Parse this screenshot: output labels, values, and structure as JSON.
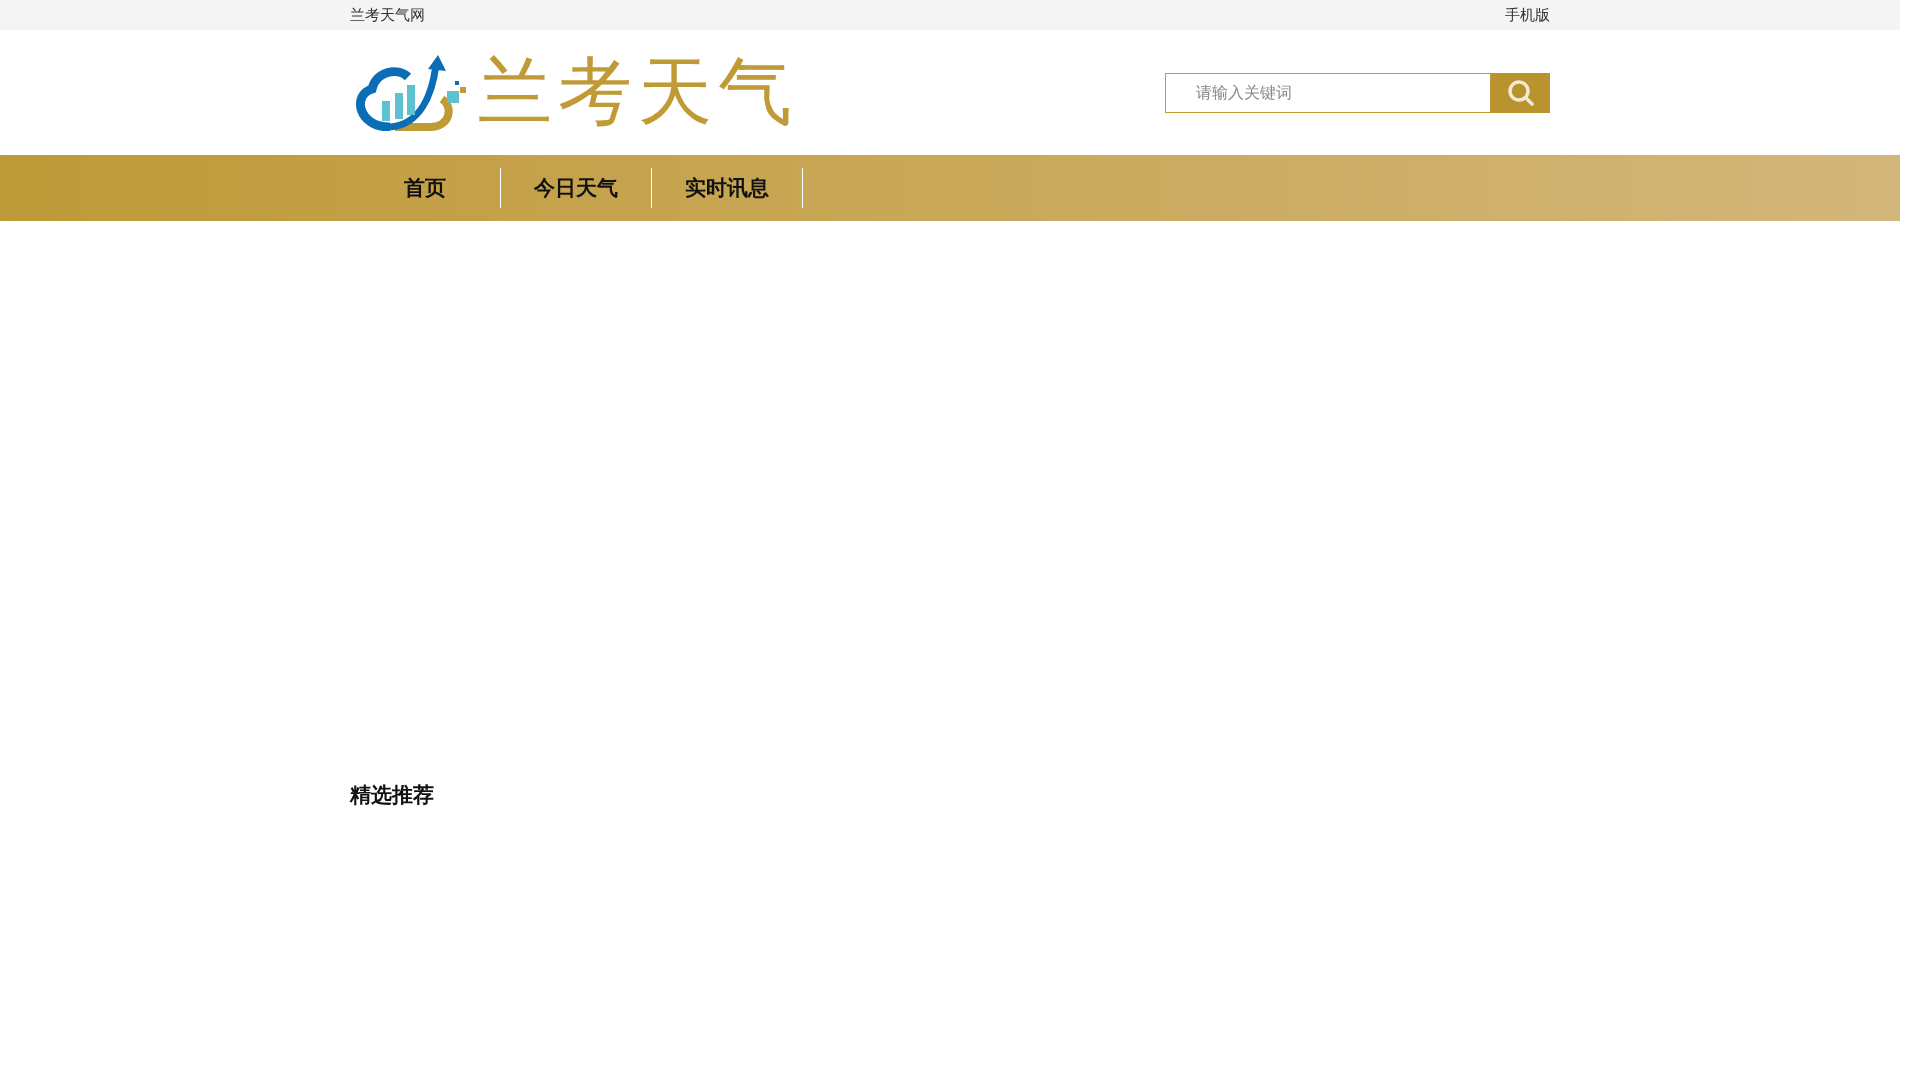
{
  "top_bar": {
    "site_name": "兰考天气网",
    "mobile_link": "手机版"
  },
  "logo": {
    "text": "兰考天气"
  },
  "search": {
    "placeholder": "请输入关键词"
  },
  "nav": [
    {
      "label": "首页"
    },
    {
      "label": "今日天气"
    },
    {
      "label": "实时讯息"
    }
  ],
  "section": {
    "title": "精选推荐"
  }
}
